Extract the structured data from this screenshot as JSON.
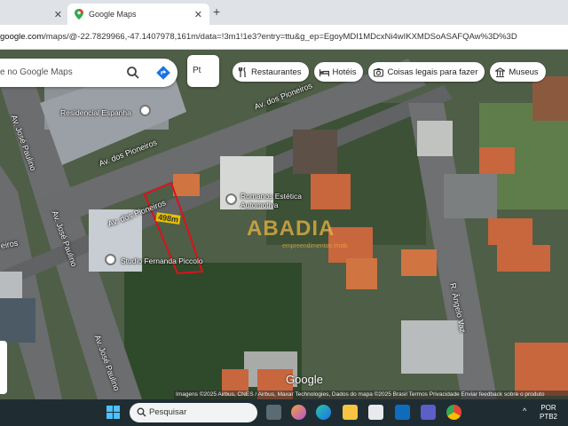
{
  "browser": {
    "tabs": [
      {
        "label": ""
      },
      {
        "label": "Google Maps"
      }
    ],
    "new_tab_label": "+",
    "url_host": "google.com",
    "url_path": "/maps/@-22.7829966,-47.1407978,161m/data=!3m1!1e3?entry=ttu&g_ep=EgoyMDI1MDcxNi4wIKXMDSoASAFQAw%3D%3D"
  },
  "maps": {
    "search_placeholder": "e no Google Maps",
    "layer_label": "Pt",
    "chips": [
      {
        "label": "Restaurantes",
        "icon": "fork-knife-icon"
      },
      {
        "label": "Hotéis",
        "icon": "bed-icon"
      },
      {
        "label": "Coisas legais para fazer",
        "icon": "camera-icon"
      },
      {
        "label": "Museus",
        "icon": "museum-icon"
      }
    ],
    "places": [
      {
        "label": "Residencial Espanha"
      },
      {
        "label": "Romanos Estética\nAutomotiva"
      },
      {
        "label": "Studio Fernanda Piccolo"
      }
    ],
    "roads": [
      {
        "label": "Av. dos Pioneiros"
      },
      {
        "label": "Av. dos Pioneiros"
      },
      {
        "label": "Av. dos Pioneiros"
      },
      {
        "label": "Av. José Paulino"
      },
      {
        "label": "Av. José Paulino"
      },
      {
        "label": "Av. José Paulino"
      },
      {
        "label": "R. Ângelo Vaz"
      },
      {
        "label": "eiros"
      }
    ],
    "area_measure": "498m",
    "watermark": "ABADIA",
    "watermark_sub": "empreendimentos imob.",
    "google_logo": "Google",
    "attribution": "Imagens ©2025 Airbus, CNES / Airbus, Maxar Technologies, Dados do mapa ©2025    Brasil    Termos    Privacidade    Enviar feedback sobre o produto"
  },
  "taskbar": {
    "search_label": "Pesquisar",
    "lang_top": "POR",
    "lang_bottom": "PTB2",
    "chevron": "^"
  }
}
